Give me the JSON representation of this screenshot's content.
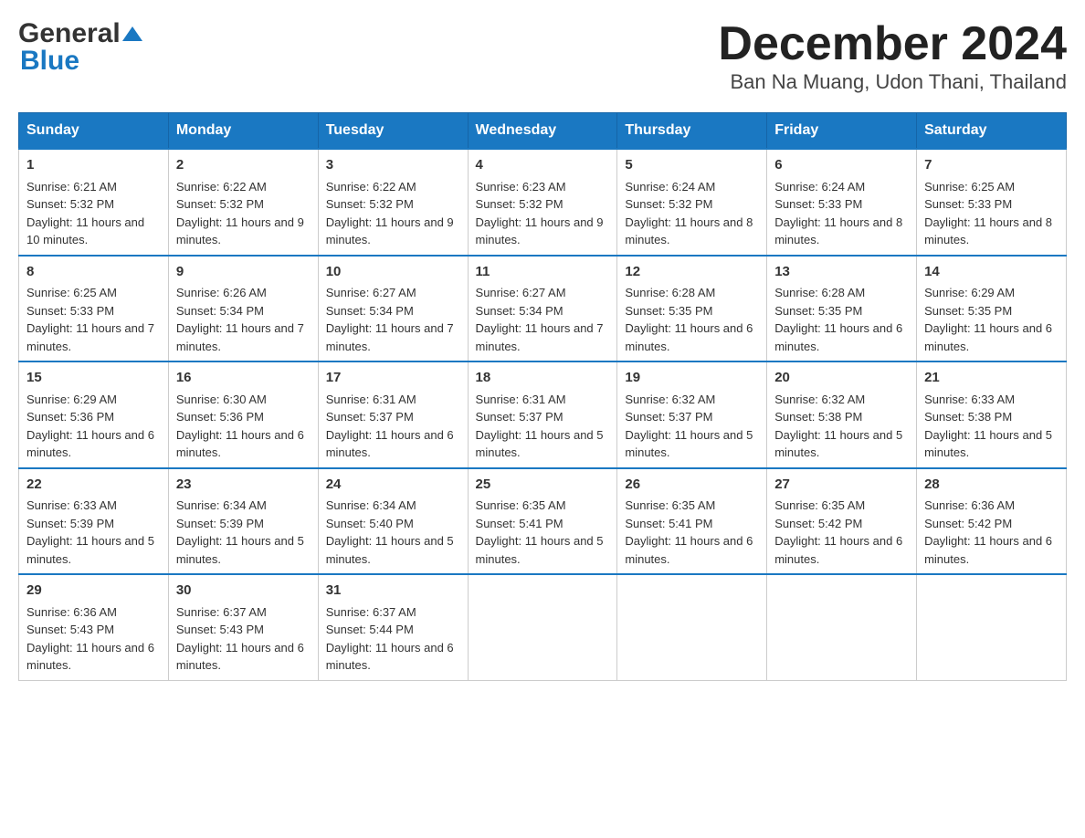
{
  "header": {
    "logo_general": "General",
    "logo_blue": "Blue",
    "month_title": "December 2024",
    "location": "Ban Na Muang, Udon Thani, Thailand"
  },
  "days_of_week": [
    "Sunday",
    "Monday",
    "Tuesday",
    "Wednesday",
    "Thursday",
    "Friday",
    "Saturday"
  ],
  "weeks": [
    [
      {
        "day": "1",
        "sunrise": "6:21 AM",
        "sunset": "5:32 PM",
        "daylight": "11 hours and 10 minutes."
      },
      {
        "day": "2",
        "sunrise": "6:22 AM",
        "sunset": "5:32 PM",
        "daylight": "11 hours and 9 minutes."
      },
      {
        "day": "3",
        "sunrise": "6:22 AM",
        "sunset": "5:32 PM",
        "daylight": "11 hours and 9 minutes."
      },
      {
        "day": "4",
        "sunrise": "6:23 AM",
        "sunset": "5:32 PM",
        "daylight": "11 hours and 9 minutes."
      },
      {
        "day": "5",
        "sunrise": "6:24 AM",
        "sunset": "5:32 PM",
        "daylight": "11 hours and 8 minutes."
      },
      {
        "day": "6",
        "sunrise": "6:24 AM",
        "sunset": "5:33 PM",
        "daylight": "11 hours and 8 minutes."
      },
      {
        "day": "7",
        "sunrise": "6:25 AM",
        "sunset": "5:33 PM",
        "daylight": "11 hours and 8 minutes."
      }
    ],
    [
      {
        "day": "8",
        "sunrise": "6:25 AM",
        "sunset": "5:33 PM",
        "daylight": "11 hours and 7 minutes."
      },
      {
        "day": "9",
        "sunrise": "6:26 AM",
        "sunset": "5:34 PM",
        "daylight": "11 hours and 7 minutes."
      },
      {
        "day": "10",
        "sunrise": "6:27 AM",
        "sunset": "5:34 PM",
        "daylight": "11 hours and 7 minutes."
      },
      {
        "day": "11",
        "sunrise": "6:27 AM",
        "sunset": "5:34 PM",
        "daylight": "11 hours and 7 minutes."
      },
      {
        "day": "12",
        "sunrise": "6:28 AM",
        "sunset": "5:35 PM",
        "daylight": "11 hours and 6 minutes."
      },
      {
        "day": "13",
        "sunrise": "6:28 AM",
        "sunset": "5:35 PM",
        "daylight": "11 hours and 6 minutes."
      },
      {
        "day": "14",
        "sunrise": "6:29 AM",
        "sunset": "5:35 PM",
        "daylight": "11 hours and 6 minutes."
      }
    ],
    [
      {
        "day": "15",
        "sunrise": "6:29 AM",
        "sunset": "5:36 PM",
        "daylight": "11 hours and 6 minutes."
      },
      {
        "day": "16",
        "sunrise": "6:30 AM",
        "sunset": "5:36 PM",
        "daylight": "11 hours and 6 minutes."
      },
      {
        "day": "17",
        "sunrise": "6:31 AM",
        "sunset": "5:37 PM",
        "daylight": "11 hours and 6 minutes."
      },
      {
        "day": "18",
        "sunrise": "6:31 AM",
        "sunset": "5:37 PM",
        "daylight": "11 hours and 5 minutes."
      },
      {
        "day": "19",
        "sunrise": "6:32 AM",
        "sunset": "5:37 PM",
        "daylight": "11 hours and 5 minutes."
      },
      {
        "day": "20",
        "sunrise": "6:32 AM",
        "sunset": "5:38 PM",
        "daylight": "11 hours and 5 minutes."
      },
      {
        "day": "21",
        "sunrise": "6:33 AM",
        "sunset": "5:38 PM",
        "daylight": "11 hours and 5 minutes."
      }
    ],
    [
      {
        "day": "22",
        "sunrise": "6:33 AM",
        "sunset": "5:39 PM",
        "daylight": "11 hours and 5 minutes."
      },
      {
        "day": "23",
        "sunrise": "6:34 AM",
        "sunset": "5:39 PM",
        "daylight": "11 hours and 5 minutes."
      },
      {
        "day": "24",
        "sunrise": "6:34 AM",
        "sunset": "5:40 PM",
        "daylight": "11 hours and 5 minutes."
      },
      {
        "day": "25",
        "sunrise": "6:35 AM",
        "sunset": "5:41 PM",
        "daylight": "11 hours and 5 minutes."
      },
      {
        "day": "26",
        "sunrise": "6:35 AM",
        "sunset": "5:41 PM",
        "daylight": "11 hours and 6 minutes."
      },
      {
        "day": "27",
        "sunrise": "6:35 AM",
        "sunset": "5:42 PM",
        "daylight": "11 hours and 6 minutes."
      },
      {
        "day": "28",
        "sunrise": "6:36 AM",
        "sunset": "5:42 PM",
        "daylight": "11 hours and 6 minutes."
      }
    ],
    [
      {
        "day": "29",
        "sunrise": "6:36 AM",
        "sunset": "5:43 PM",
        "daylight": "11 hours and 6 minutes."
      },
      {
        "day": "30",
        "sunrise": "6:37 AM",
        "sunset": "5:43 PM",
        "daylight": "11 hours and 6 minutes."
      },
      {
        "day": "31",
        "sunrise": "6:37 AM",
        "sunset": "5:44 PM",
        "daylight": "11 hours and 6 minutes."
      },
      null,
      null,
      null,
      null
    ]
  ],
  "labels": {
    "sunrise": "Sunrise:",
    "sunset": "Sunset:",
    "daylight": "Daylight:"
  }
}
